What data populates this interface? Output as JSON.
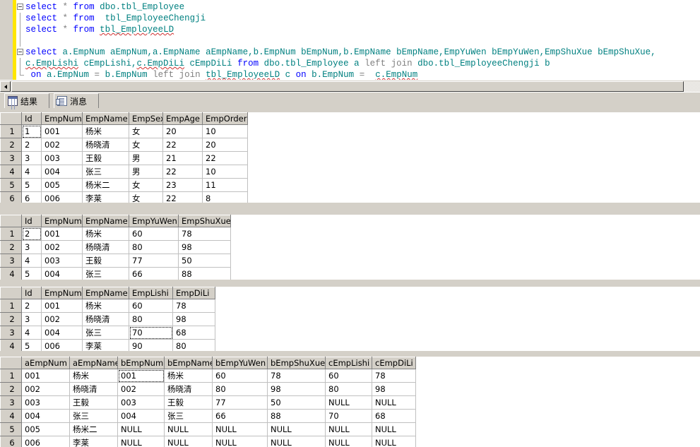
{
  "editor": {
    "lines": [
      {
        "outline": "box-start",
        "tokens": [
          {
            "t": "select",
            "c": "kw"
          },
          {
            "t": " ",
            "c": "sym"
          },
          {
            "t": "*",
            "c": "op"
          },
          {
            "t": " ",
            "c": "sym"
          },
          {
            "t": "from",
            "c": "kw"
          },
          {
            "t": " ",
            "c": "sym"
          },
          {
            "t": "dbo.tbl_Employee",
            "c": "ident"
          }
        ]
      },
      {
        "outline": "bar",
        "tokens": [
          {
            "t": "select",
            "c": "kw"
          },
          {
            "t": " ",
            "c": "sym"
          },
          {
            "t": "*",
            "c": "op"
          },
          {
            "t": " ",
            "c": "sym"
          },
          {
            "t": "from",
            "c": "kw"
          },
          {
            "t": "  ",
            "c": "sym"
          },
          {
            "t": "tbl_EmployeeChengji",
            "c": "ident"
          }
        ]
      },
      {
        "outline": "bar",
        "tokens": [
          {
            "t": "select",
            "c": "kw"
          },
          {
            "t": " ",
            "c": "sym"
          },
          {
            "t": "*",
            "c": "op"
          },
          {
            "t": " ",
            "c": "sym"
          },
          {
            "t": "from",
            "c": "kw"
          },
          {
            "t": " ",
            "c": "sym"
          },
          {
            "t": "tbl_EmployeeLD",
            "c": "ident squiggle"
          }
        ]
      },
      {
        "outline": "bar",
        "tokens": []
      },
      {
        "outline": "box-start",
        "tokens": [
          {
            "t": "select",
            "c": "kw"
          },
          {
            "t": " ",
            "c": "sym"
          },
          {
            "t": "a.EmpNum aEmpNum,a.EmpName aEmpName,b.EmpNum bEmpNum,b.EmpName bEmpName,EmpYuWen bEmpYuWen,EmpShuXue bEmpShuXue,",
            "c": "ident"
          }
        ]
      },
      {
        "outline": "bar",
        "tokens": [
          {
            "t": "c.EmpLishi",
            "c": "ident squiggle"
          },
          {
            "t": " cEmpLishi,",
            "c": "ident"
          },
          {
            "t": "c.EmpDiLi",
            "c": "ident squiggle"
          },
          {
            "t": " cEmpDiLi ",
            "c": "ident"
          },
          {
            "t": "from",
            "c": "kw"
          },
          {
            "t": " ",
            "c": "sym"
          },
          {
            "t": "dbo.tbl_Employee a ",
            "c": "ident"
          },
          {
            "t": "left join",
            "c": "plain"
          },
          {
            "t": " dbo.tbl_EmployeeChengji b",
            "c": "ident"
          }
        ]
      },
      {
        "outline": "tick",
        "tokens": [
          {
            "t": " ",
            "c": "sym"
          },
          {
            "t": "on",
            "c": "kw"
          },
          {
            "t": " a.EmpNum ",
            "c": "ident"
          },
          {
            "t": "=",
            "c": "op"
          },
          {
            "t": " b.EmpNum ",
            "c": "ident"
          },
          {
            "t": "left join",
            "c": "plain"
          },
          {
            "t": " ",
            "c": "sym"
          },
          {
            "t": "tbl_EmployeeLD",
            "c": "ident squiggle"
          },
          {
            "t": " c ",
            "c": "ident"
          },
          {
            "t": "on",
            "c": "kw"
          },
          {
            "t": " b.EmpNum ",
            "c": "ident"
          },
          {
            "t": "=",
            "c": "op"
          },
          {
            "t": "  ",
            "c": "sym"
          },
          {
            "t": "c.EmpNum",
            "c": "ident squiggle"
          }
        ]
      }
    ]
  },
  "hscroll": {
    "left_arrow": "scroll-left",
    "thumb": "horizontal-thumb"
  },
  "tabs": [
    {
      "label": "结果",
      "icon": "grid-icon",
      "selected": true
    },
    {
      "label": "消息",
      "icon": "message-icon",
      "selected": false
    }
  ],
  "grids": [
    {
      "name": "employee-grid",
      "columns": [
        "Id",
        "EmpNum",
        "EmpName",
        "EmpSex",
        "EmpAge",
        "EmpOrder"
      ],
      "widths": [
        28,
        58,
        66,
        48,
        56,
        64
      ],
      "rows": [
        {
          "n": "1",
          "cells": [
            "1",
            "001",
            "杨米",
            "女",
            "20",
            "10"
          ],
          "sel": 0
        },
        {
          "n": "2",
          "cells": [
            "2",
            "002",
            "杨晓清",
            "女",
            "22",
            "20"
          ]
        },
        {
          "n": "3",
          "cells": [
            "3",
            "003",
            "王毅",
            "男",
            "21",
            "22"
          ]
        },
        {
          "n": "4",
          "cells": [
            "4",
            "004",
            "张三",
            "男",
            "22",
            "10"
          ]
        },
        {
          "n": "5",
          "cells": [
            "5",
            "005",
            "杨米二",
            "女",
            "23",
            "11"
          ]
        },
        {
          "n": "6",
          "cells": [
            "6",
            "006",
            "李莱",
            "女",
            "22",
            "8"
          ]
        }
      ]
    },
    {
      "name": "chengji-grid",
      "columns": [
        "Id",
        "EmpNum",
        "EmpName",
        "EmpYuWen",
        "EmpShuXue"
      ],
      "widths": [
        28,
        58,
        66,
        70,
        74
      ],
      "rows": [
        {
          "n": "1",
          "cells": [
            "2",
            "001",
            "杨米",
            "60",
            "78"
          ],
          "sel": 0
        },
        {
          "n": "2",
          "cells": [
            "3",
            "002",
            "杨晓清",
            "80",
            "98"
          ]
        },
        {
          "n": "3",
          "cells": [
            "4",
            "003",
            "王毅",
            "77",
            "50"
          ]
        },
        {
          "n": "4",
          "cells": [
            "5",
            "004",
            "张三",
            "66",
            "88"
          ]
        }
      ]
    },
    {
      "name": "ld-grid",
      "columns": [
        "Id",
        "EmpNum",
        "EmpName",
        "EmpLishi",
        "EmpDiLi"
      ],
      "widths": [
        28,
        58,
        66,
        62,
        60
      ],
      "rows": [
        {
          "n": "1",
          "cells": [
            "2",
            "001",
            "杨米",
            "60",
            "78"
          ]
        },
        {
          "n": "2",
          "cells": [
            "3",
            "002",
            "杨晓清",
            "80",
            "98"
          ]
        },
        {
          "n": "3",
          "cells": [
            "4",
            "004",
            "张三",
            "70",
            "68"
          ],
          "sel": 3
        },
        {
          "n": "4",
          "cells": [
            "5",
            "006",
            "李莱",
            "90",
            "80"
          ]
        }
      ]
    },
    {
      "name": "join-grid",
      "columns": [
        "aEmpNum",
        "aEmpName",
        "bEmpNum",
        "bEmpName",
        "bEmpYuWen",
        "bEmpShuXue",
        "cEmpLishi",
        "cEmpDiLi"
      ],
      "widths": [
        68,
        68,
        66,
        68,
        78,
        82,
        66,
        62
      ],
      "rows": [
        {
          "n": "1",
          "cells": [
            "001",
            "杨米",
            "001",
            "杨米",
            "60",
            "78",
            "60",
            "78"
          ],
          "sel": 2
        },
        {
          "n": "2",
          "cells": [
            "002",
            "杨晓清",
            "002",
            "杨晓清",
            "80",
            "98",
            "80",
            "98"
          ]
        },
        {
          "n": "3",
          "cells": [
            "003",
            "王毅",
            "003",
            "王毅",
            "77",
            "50",
            "NULL",
            "NULL"
          ]
        },
        {
          "n": "4",
          "cells": [
            "004",
            "张三",
            "004",
            "张三",
            "66",
            "88",
            "70",
            "68"
          ]
        },
        {
          "n": "5",
          "cells": [
            "005",
            "杨米二",
            "NULL",
            "NULL",
            "NULL",
            "NULL",
            "NULL",
            "NULL"
          ]
        },
        {
          "n": "6",
          "cells": [
            "006",
            "李莱",
            "NULL",
            "NULL",
            "NULL",
            "NULL",
            "NULL",
            "NULL"
          ]
        }
      ]
    }
  ],
  "colors": {
    "keyword": "#0000ff",
    "identifier": "#008080",
    "null_cell_bg": "#ffffdd",
    "selected_cell_bg": "#c8c8c8",
    "chrome": "#d4d0c8",
    "change_bar": "#ffe600"
  }
}
